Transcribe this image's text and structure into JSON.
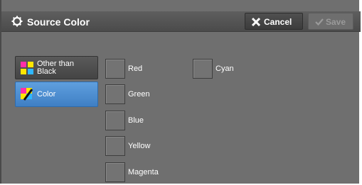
{
  "header": {
    "title": "Source Color",
    "cancel_label": "Cancel",
    "save_label": "Save"
  },
  "left_options": [
    {
      "label": "Other than Black",
      "line1": "Other than",
      "line2": "Black",
      "selected": false
    },
    {
      "label": "Color",
      "selected": true
    }
  ],
  "colors": [
    {
      "label": "Red",
      "checked": false
    },
    {
      "label": "Green",
      "checked": false
    },
    {
      "label": "Blue",
      "checked": false
    },
    {
      "label": "Yellow",
      "checked": false
    },
    {
      "label": "Magenta",
      "checked": false
    },
    {
      "label": "Cyan",
      "checked": false
    }
  ],
  "icons": {
    "title": "gear-icon",
    "cancel": "x-icon",
    "save": "check-icon",
    "other": "color-swatch-icon",
    "color": "color-pen-icon"
  },
  "theme": {
    "background": "#6f6f6f",
    "selected_blue": "#4a8ad0"
  }
}
